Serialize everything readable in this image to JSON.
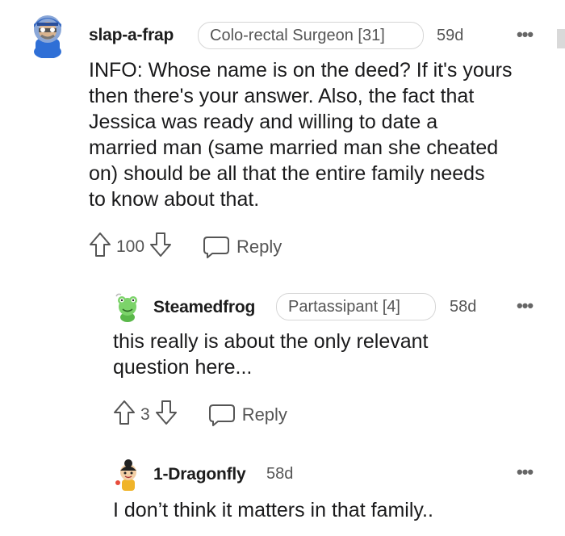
{
  "comments": [
    {
      "username": "slap-a-frap",
      "flair": "Colo-rectal Surgeon [31]",
      "age": "59d",
      "body_lines": [
        "INFO: Whose name is on the deed? If it's yours",
        "then there's your answer. Also, the fact that",
        "Jessica was ready and willing to date a",
        "married man (same married man she cheated",
        "on) should be all that the entire family needs",
        "to know about that."
      ],
      "votes": "100",
      "reply_label": "Reply",
      "more_label": "•••"
    },
    {
      "username": "Steamedfrog",
      "flair": "Partassipant [4]",
      "age": "58d",
      "body_lines": [
        "this really is about the only relevant",
        "question here..."
      ],
      "votes": "3",
      "reply_label": "Reply",
      "more_label": "•••"
    },
    {
      "username": "1-Dragonfly",
      "age": "58d",
      "body_lines": [
        "I don’t think it matters in that family.."
      ],
      "more_label": "•••"
    }
  ],
  "colors": {
    "text": "#1a1a1b",
    "muted": "#555555",
    "flair_border": "#d6d6d6"
  }
}
